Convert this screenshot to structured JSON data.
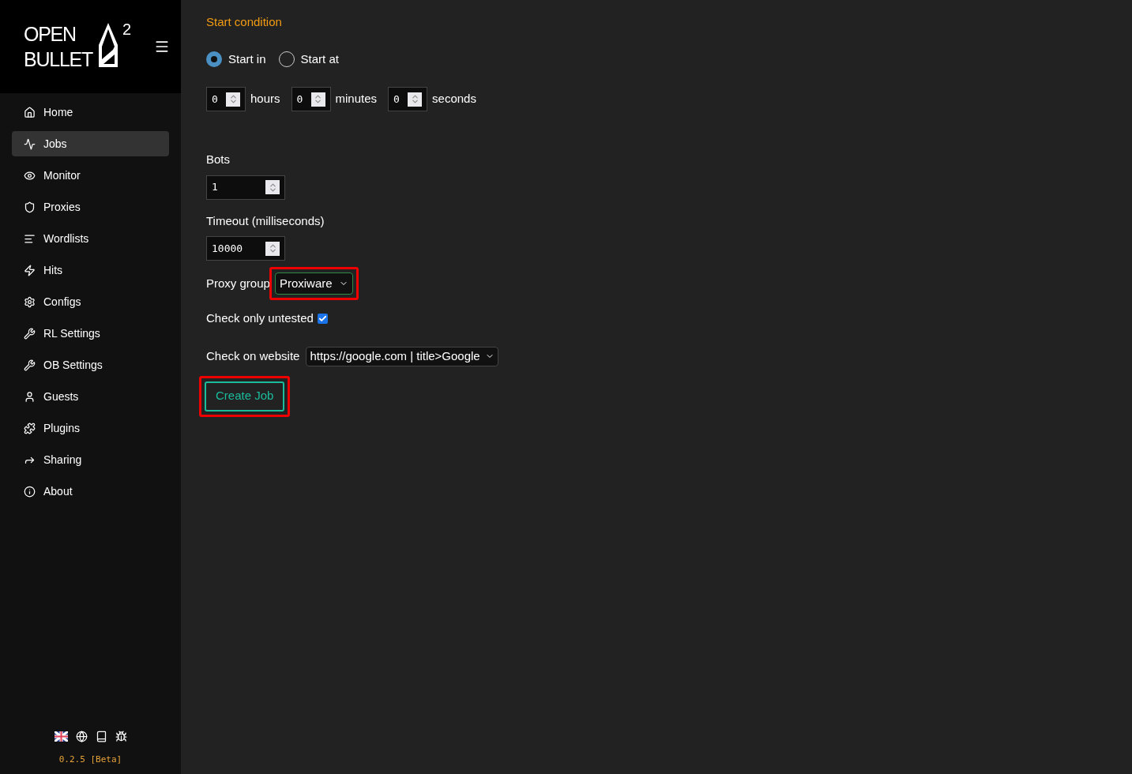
{
  "logo": {
    "line_1": "OPEN",
    "line_2": "BULLET",
    "superscript": "2"
  },
  "sidebar": {
    "items": [
      {
        "label": "Home",
        "selected": false
      },
      {
        "label": "Jobs",
        "selected": true
      },
      {
        "label": "Monitor",
        "selected": false
      },
      {
        "label": "Proxies",
        "selected": false
      },
      {
        "label": "Wordlists",
        "selected": false
      },
      {
        "label": "Hits",
        "selected": false
      },
      {
        "label": "Configs",
        "selected": false
      },
      {
        "label": "RL Settings",
        "selected": false
      },
      {
        "label": "OB Settings",
        "selected": false
      },
      {
        "label": "Guests",
        "selected": false
      },
      {
        "label": "Plugins",
        "selected": false
      },
      {
        "label": "Sharing",
        "selected": false
      },
      {
        "label": "About",
        "selected": false
      }
    ],
    "version": "0.2.5 [Beta]"
  },
  "form": {
    "start_condition": {
      "title": "Start condition",
      "options": [
        {
          "label": "Start in",
          "selected": true
        },
        {
          "label": "Start at",
          "selected": false
        }
      ],
      "fields": [
        {
          "value": "0",
          "unit": "hours"
        },
        {
          "value": "0",
          "unit": "minutes"
        },
        {
          "value": "0",
          "unit": "seconds"
        }
      ]
    },
    "bots": {
      "label": "Bots",
      "value": "1"
    },
    "timeout": {
      "label": "Timeout (milliseconds)",
      "value": "10000"
    },
    "proxy_group": {
      "label": "Proxy group",
      "value": "Proxiware",
      "highlighted": true
    },
    "check_only_untested": {
      "label": "Check only untested",
      "checked": true
    },
    "check_on_website": {
      "label": "Check on website",
      "value": "https://google.com | title>Google"
    },
    "create_button": {
      "label": "Create Job",
      "highlighted": true
    }
  }
}
